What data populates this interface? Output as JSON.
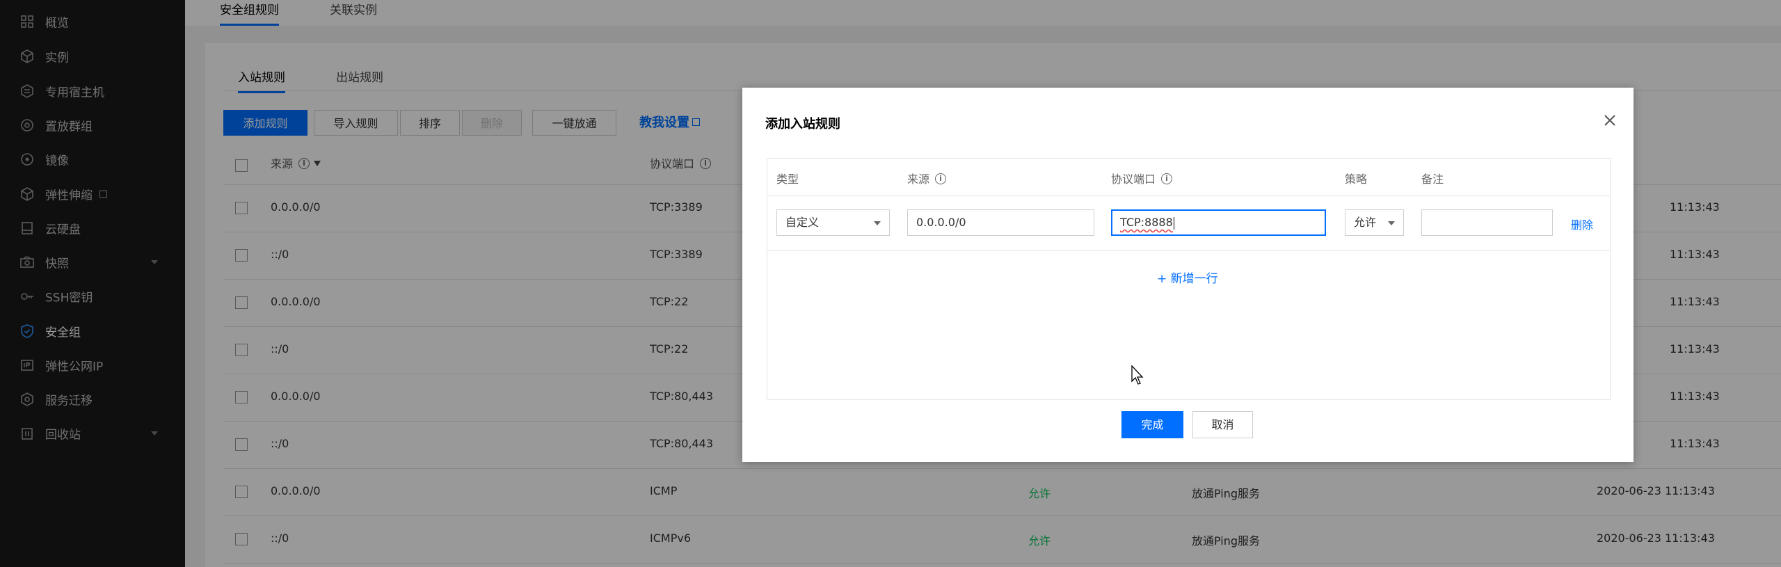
{
  "sidebar": {
    "items": [
      {
        "label": "概览",
        "icon": "grid-icon"
      },
      {
        "label": "实例",
        "icon": "cube-icon"
      },
      {
        "label": "专用宿主机",
        "icon": "host-icon"
      },
      {
        "label": "置放群组",
        "icon": "placement-group-icon"
      },
      {
        "label": "镜像",
        "icon": "image-icon"
      },
      {
        "label": "弹性伸缩",
        "icon": "auto-scaling-icon"
      },
      {
        "label": "云硬盘",
        "icon": "disk-icon"
      },
      {
        "label": "快照",
        "icon": "camera-icon"
      },
      {
        "label": "SSH密钥",
        "icon": "key-icon"
      },
      {
        "label": "安全组",
        "icon": "shield-icon"
      },
      {
        "label": "弹性公网IP",
        "icon": "ip-icon"
      },
      {
        "label": "服务迁移",
        "icon": "migrate-icon"
      },
      {
        "label": "回收站",
        "icon": "recycle-icon"
      }
    ],
    "active": "安全组"
  },
  "top_tabs": [
    {
      "label": "安全组规则",
      "active": true
    },
    {
      "label": "关联实例",
      "active": false
    }
  ],
  "sub_tabs": [
    {
      "label": "入站规则",
      "active": true
    },
    {
      "label": "出站规则",
      "active": false
    }
  ],
  "toolbar": {
    "add_rule": "添加规则",
    "import_rules": "导入规则",
    "sort": "排序",
    "delete": "删除",
    "open_all": "一键放通",
    "help_link": "教我设置"
  },
  "table": {
    "headers": {
      "source": "来源",
      "port": "协议端口"
    },
    "rows": [
      {
        "source": "0.0.0.0/0",
        "port": "TCP:3389",
        "policy": "",
        "note": "",
        "time": "11:13:43"
      },
      {
        "source": "::/0",
        "port": "TCP:3389",
        "policy": "",
        "note": "",
        "time": "11:13:43"
      },
      {
        "source": "0.0.0.0/0",
        "port": "TCP:22",
        "policy": "",
        "note": "",
        "time": "11:13:43"
      },
      {
        "source": "::/0",
        "port": "TCP:22",
        "policy": "",
        "note": "",
        "time": "11:13:43"
      },
      {
        "source": "0.0.0.0/0",
        "port": "TCP:80,443",
        "policy": "",
        "note": "",
        "time": "11:13:43"
      },
      {
        "source": "::/0",
        "port": "TCP:80,443",
        "policy": "",
        "note": "",
        "time": "11:13:43"
      },
      {
        "source": "0.0.0.0/0",
        "port": "ICMP",
        "policy": "允许",
        "note": "放通Ping服务",
        "time": "2020-06-23 11:13:43"
      },
      {
        "source": "::/0",
        "port": "ICMPv6",
        "policy": "允许",
        "note": "放通Ping服务",
        "time": "2020-06-23 11:13:43"
      }
    ]
  },
  "modal": {
    "title": "添加入站规则",
    "columns": {
      "type": "类型",
      "source": "来源",
      "port": "协议端口",
      "policy": "策略",
      "note": "备注"
    },
    "row": {
      "type": "自定义",
      "source": "0.0.0.0/0",
      "port": "TCP:8888",
      "policy": "允许",
      "note": "",
      "delete": "删除"
    },
    "add_row": "+ 新增一行",
    "ok": "完成",
    "cancel": "取消"
  }
}
